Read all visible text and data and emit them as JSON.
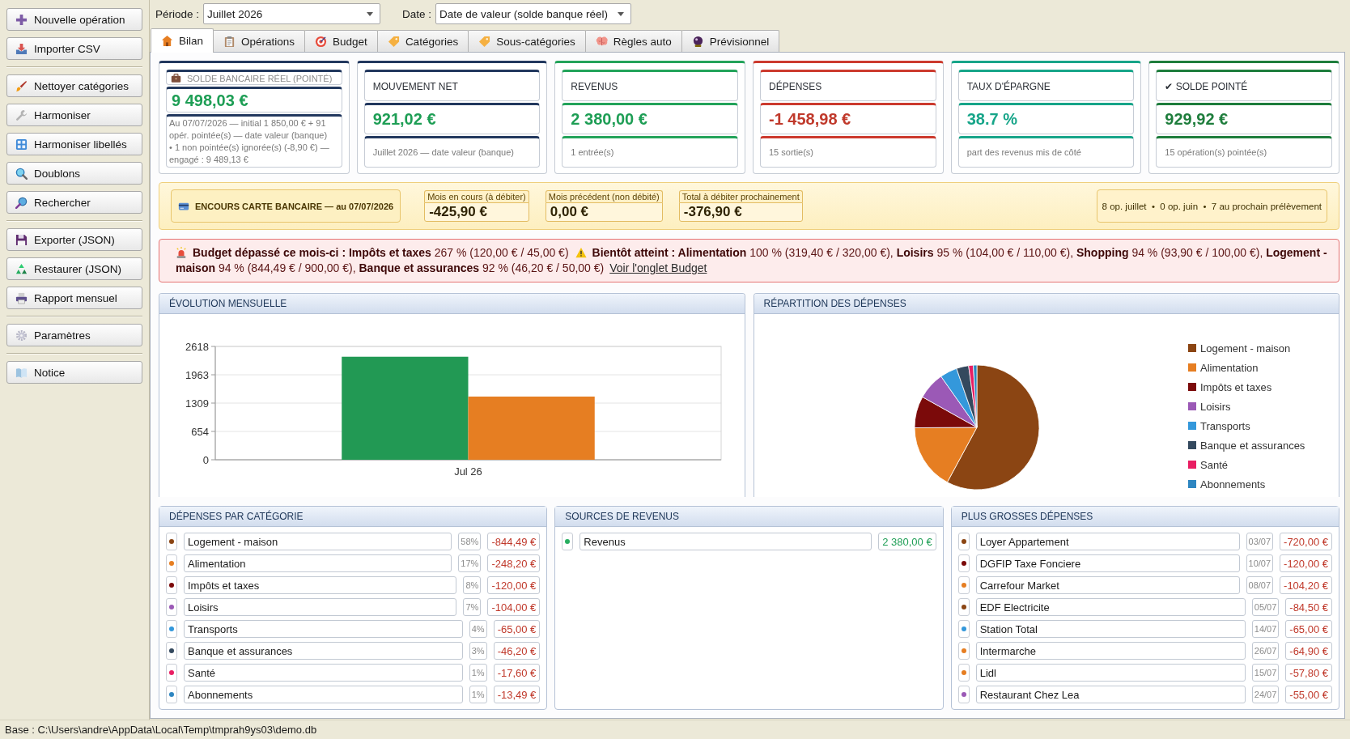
{
  "toolbar": {
    "period": {
      "label": "Période :",
      "value": "Juillet 2026"
    },
    "date": {
      "label": "Date :",
      "value": "Date de valeur (solde banque réel)"
    }
  },
  "sidebar": {
    "groups": [
      {
        "items": [
          {
            "label": "Nouvelle opération"
          },
          {
            "label": "Importer CSV"
          }
        ]
      },
      {
        "items": [
          {
            "label": "Nettoyer catégories"
          },
          {
            "label": "Harmoniser"
          },
          {
            "label": "Harmoniser libellés"
          },
          {
            "label": "Doublons"
          },
          {
            "label": "Rechercher"
          }
        ]
      },
      {
        "items": [
          {
            "label": "Exporter (JSON)"
          },
          {
            "label": "Restaurer (JSON)"
          },
          {
            "label": "Rapport mensuel"
          }
        ]
      },
      {
        "items": [
          {
            "label": "Paramètres"
          }
        ]
      },
      {
        "items": [
          {
            "label": "Notice"
          }
        ]
      }
    ]
  },
  "tabs": [
    {
      "label": "Bilan",
      "selected": true
    },
    {
      "label": "Opérations",
      "selected": false
    },
    {
      "label": "Budget",
      "selected": false
    },
    {
      "label": "Catégories",
      "selected": false
    },
    {
      "label": "Sous-catégories",
      "selected": false
    },
    {
      "label": "Règles auto",
      "selected": false
    },
    {
      "label": "Prévisionnel",
      "selected": false
    }
  ],
  "kpis": [
    {
      "kind": "balance",
      "title": "SOLDE BANCAIRE RÉEL (POINTÉ)",
      "value": "9 498,03 €",
      "note": "Au 07/07/2026 — initial 1 850,00 € + 91 opér. pointée(s) — date valeur (banque) • 1 non pointée(s) ignorée(s) (-8,90 €) — engagé : 9 489,13 €"
    },
    {
      "kind": "net",
      "title": "MOUVEMENT NET",
      "value": "921,02 €",
      "note": "Juillet 2026 — date valeur (banque)"
    },
    {
      "kind": "income",
      "title": "REVENUS",
      "value": "2 380,00 €",
      "note": "1 entrée(s)"
    },
    {
      "kind": "expense",
      "title": "DÉPENSES",
      "value": "-1 458,98 €",
      "note": "15 sortie(s)"
    },
    {
      "kind": "rate",
      "title": "TAUX D'ÉPARGNE",
      "value": "38.7 %",
      "note": "part des revenus mis de côté"
    },
    {
      "kind": "reconciled",
      "title": "✔ SOLDE POINTÉ",
      "value": "929,92 €",
      "note": "15 opération(s) pointée(s)"
    }
  ],
  "card_outstanding": {
    "title": "ENCOURS CARTE BANCAIRE — au 07/07/2026",
    "figures": [
      {
        "label": "Mois en cours (à débiter)",
        "value": "-425,90 €"
      },
      {
        "label": "Mois précédent (non débité)",
        "value": "0,00 €"
      },
      {
        "label": "Total à débiter prochainement",
        "value": "-376,90 €"
      }
    ],
    "summary": "8 op. juillet  •  0 op. juin  •  7 au prochain prélèvement"
  },
  "alert": {
    "over": "**Budget dépassé ce mois-ci : Impôts et taxes** 267 % (120,00 € / 45,00 €)",
    "near": "**Bientôt atteint : Alimentation** 100 % (319,40 € / 320,00 €), **Loisirs** 95 % (104,00 € / 110,00 €), **Shopping** 94 % (93,90 € / 100,00 €), **Logement - maison** 94 % (844,49 € / 900,00 €), **Banque et assurances** 92 % (46,20 € / 50,00 €)",
    "link": "Voir l'onglet Budget"
  },
  "charts": [
    {
      "title": "ÉVOLUTION MENSUELLE",
      "chart_data": {
        "type": "bar",
        "categories": [
          "Jul 26"
        ],
        "series": [
          {
            "color": "#229954",
            "values": [
              2380
            ]
          },
          {
            "color": "#e67e22",
            "values": [
              1460
            ]
          }
        ],
        "ylim": [
          0,
          2618
        ],
        "yticks": [
          0,
          654,
          1309,
          1963,
          2618
        ],
        "grid": true
      }
    },
    {
      "title": "RÉPARTITION DES DÉPENSES",
      "chart_data": {
        "type": "pie",
        "categories": [
          "Logement - maison",
          "Alimentation",
          "Impôts et taxes",
          "Loisirs",
          "Transports",
          "Banque et assurances",
          "Santé",
          "Abonnements"
        ],
        "values": [
          57.88,
          17.01,
          8.22,
          7.13,
          4.46,
          3.17,
          1.21,
          0.92
        ],
        "colors": [
          "#8b4513",
          "#e67e22",
          "#7b0a0a",
          "#9b59b6",
          "#3498db",
          "#34495e",
          "#e91e63",
          "#2e86c1"
        ],
        "legend": "right"
      }
    }
  ],
  "panels": [
    {
      "kind": "categories",
      "title": "DÉPENSES PAR CATÉGORIE",
      "rows": [
        {
          "color": "#8b4513",
          "name": "Logement - maison",
          "share": "58%",
          "amount": "-844,49 €"
        },
        {
          "color": "#e67e22",
          "name": "Alimentation",
          "share": "17%",
          "amount": "-248,20 €"
        },
        {
          "color": "#7b0a0a",
          "name": "Impôts et taxes",
          "share": "8%",
          "amount": "-120,00 €"
        },
        {
          "color": "#9b59b6",
          "name": "Loisirs",
          "share": "7%",
          "amount": "-104,00 €"
        },
        {
          "color": "#3498db",
          "name": "Transports",
          "share": "4%",
          "amount": "-65,00 €"
        },
        {
          "color": "#34495e",
          "name": "Banque et assurances",
          "share": "3%",
          "amount": "-46,20 €"
        },
        {
          "color": "#e91e63",
          "name": "Santé",
          "share": "1%",
          "amount": "-17,60 €"
        },
        {
          "color": "#2e86c1",
          "name": "Abonnements",
          "share": "1%",
          "amount": "-13,49 €"
        }
      ]
    },
    {
      "kind": "income",
      "title": "SOURCES DE REVENUS",
      "rows": [
        {
          "color": "#27ae60",
          "name": "Revenus",
          "amount": "2 380,00 €"
        }
      ]
    },
    {
      "kind": "largest",
      "title": "PLUS GROSSES DÉPENSES",
      "rows": [
        {
          "color": "#8b4513",
          "name": "Loyer Appartement",
          "date": "03/07",
          "amount": "-720,00 €"
        },
        {
          "color": "#7b0a0a",
          "name": "DGFIP Taxe Fonciere",
          "date": "10/07",
          "amount": "-120,00 €"
        },
        {
          "color": "#e67e22",
          "name": "Carrefour Market",
          "date": "08/07",
          "amount": "-104,20 €"
        },
        {
          "color": "#8b4513",
          "name": "EDF Electricite",
          "date": "05/07",
          "amount": "-84,50 €"
        },
        {
          "color": "#3498db",
          "name": "Station Total",
          "date": "14/07",
          "amount": "-65,00 €"
        },
        {
          "color": "#e67e22",
          "name": "Intermarche",
          "date": "26/07",
          "amount": "-64,90 €"
        },
        {
          "color": "#e67e22",
          "name": "Lidl",
          "date": "15/07",
          "amount": "-57,80 €"
        },
        {
          "color": "#9b59b6",
          "name": "Restaurant Chez Lea",
          "date": "24/07",
          "amount": "-55,00 €"
        }
      ]
    }
  ],
  "status_bar": {
    "text": "Base : C:\\Users\\andre\\AppData\\Local\\Temp\\tmprah9ys03\\demo.db"
  }
}
